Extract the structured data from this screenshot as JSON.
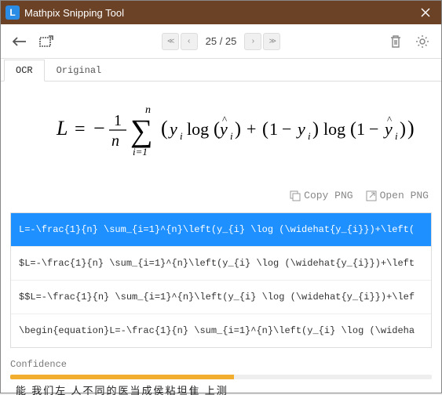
{
  "window": {
    "title": "Mathpix Snipping Tool",
    "logo_letter": "L"
  },
  "pager": {
    "current": "25",
    "total": "25"
  },
  "tabs": {
    "ocr": "OCR",
    "original": "Original"
  },
  "actions": {
    "copy": "Copy PNG",
    "open": "Open PNG"
  },
  "latex_rows": [
    "L=-\\frac{1}{n} \\sum_{i=1}^{n}\\left(y_{i} \\log (\\widehat{y_{i}})+\\left(",
    "$L=-\\frac{1}{n} \\sum_{i=1}^{n}\\left(y_{i} \\log (\\widehat{y_{i}})+\\left",
    "$$L=-\\frac{1}{n} \\sum_{i=1}^{n}\\left(y_{i} \\log (\\widehat{y_{i}})+\\lef",
    "\\begin{equation}L=-\\frac{1}{n} \\sum_{i=1}^{n}\\left(y_{i} \\log (\\wideha"
  ],
  "confidence": {
    "label": "Confidence",
    "percent": 53
  },
  "chart_data": {
    "type": "bar",
    "title": "Confidence",
    "categories": [
      "confidence"
    ],
    "values": [
      53
    ],
    "ylim": [
      0,
      100
    ]
  },
  "bottom_text": "能  我们左 人不同的医当成侯粘坦隹 上测"
}
